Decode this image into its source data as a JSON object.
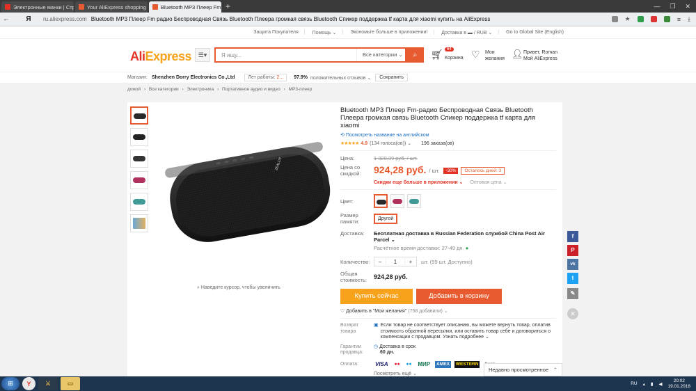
{
  "browser": {
    "tabs": [
      {
        "title": "Электронные манки | Стра",
        "color": "#e43225",
        "active": false
      },
      {
        "title": "Your AliExpress shopping ca",
        "color": "#e85a2f",
        "active": false
      },
      {
        "title": "Bluetooth MP3 Плеер Fm",
        "color": "#e85a2f",
        "active": true
      }
    ],
    "url_domain": "ru.aliexpress.com",
    "url_title": "Bluetooth MP3 Плеер Fm радио Беспроводная Связь Bluetooth Плеера громкая связь Bluetooth Спикер поддержка tf карта для xiaomi купить на AliExpress",
    "yandex_icon": "Я"
  },
  "topstrip": {
    "buyer_protection": "Защита Покупателя",
    "help": "Помощь ⌄",
    "app": "Экономьте больше в приложении!",
    "delivery": "Доставка в ▬ / RUB ⌄",
    "global": "Go to Global Site (English)"
  },
  "header": {
    "logo_a": "Ali",
    "logo_b": "Express",
    "search_placeholder": "Я ищу...",
    "search_category": "Все категории  ⌄",
    "cart_count": "64",
    "cart_label": "Корзина",
    "wish_label": "Мои желания",
    "user_line1": "Привет, Roman",
    "user_line2": "Мой AliExpress"
  },
  "store": {
    "label": "Магазин:",
    "name": "Shenzhen Dorry Electronics Co.,Ltd",
    "years_label": "Лет работы:",
    "years_value": "2...",
    "positive": "97.9%",
    "positive_label": "положительных отзывов ⌄",
    "save": "Сохранить"
  },
  "breadcrumbs": [
    "домой",
    "›",
    "Все категории",
    "›",
    "Электроника",
    "›",
    "Портативное аудио и видео",
    "›",
    "MP3-плеер"
  ],
  "gallery": {
    "zoom_hint": "Наведите курсор, чтобы увеличить",
    "brand_mark": "ZEALOT"
  },
  "product": {
    "title": "Bluetooth MP3 Плеер Fm-радио Беспроводная Связь Bluetooth Плеера громкая связь Bluetooth Спикер поддержка tf карта для xiaomi",
    "translate": "Посмотреть название на английском",
    "stars": "★★★★★",
    "rating": "4.9",
    "votes": "(134 голоса(ов)) ⌄",
    "orders": "196 заказа(ов)",
    "price_label": "Цена:",
    "old_price": "1 320,39 руб. / шт.",
    "sale_label": "Цена со скидкой:",
    "new_price": "924,28 руб.",
    "per_unit": "/ шт.",
    "discount": "-30%",
    "days_left": "Осталось дней: 3",
    "app_deal": "Скидки еще больше в приложении ⌄",
    "wholesale": "Оптовая цена ⌄",
    "color_label": "Цвет:",
    "memory_label": "Размер памяти:",
    "memory_option": "Другой",
    "delivery_label": "Доставка:",
    "delivery_text": "Бесплатная доставка в Russian Federation службой China Post Air Parcel ⌄",
    "delivery_time": "Расчётное время доставки: 27-49 дн.",
    "qty_label": "Количество:",
    "qty_value": "1",
    "qty_note": "шт. (99 шт. Доступно)",
    "total_label": "Общая стоимость:",
    "total": "924,28 руб.",
    "buy_now": "Купить сейчас",
    "add_cart": "Добавить в корзину",
    "wishlist": "Добавить в \"Мои желания\"",
    "wishlist_count": "(758 добавили) ⌄",
    "return_label": "Возврат товара",
    "return_text": "Если товар не соответствует описанию, вы можете вернуть товар, оплатив стоимость обратной пересылки, или оставить товар себе и договориться о компенсации с продавцом. Узнать подробнее ⌄",
    "guarantee_label": "Гарантии продавца:",
    "guarantee_text": "Доставка в срок",
    "guarantee_days": "60 дн.",
    "payment_label": "Оплата:",
    "payment_methods": [
      "VISA",
      "●●",
      "●●",
      "МИР",
      "AMEX",
      "WESTERN",
      "Bank"
    ],
    "more_payments": "Посмотреть ещё ⌄"
  },
  "colors": {
    "accent": "#e85a2f",
    "brand_red": "#e43225",
    "brand_orange": "#f7a21b",
    "swatch_black": "#2a2a2a",
    "swatch_pink": "#b0305e",
    "swatch_teal": "#3f9a98"
  },
  "social": [
    "f",
    "P",
    "vk",
    "t",
    "✎"
  ],
  "recent_viewed": "Недавно просмотренное",
  "taskbar": {
    "lang": "RU",
    "time": "20:02",
    "date": "19.01.2018"
  }
}
